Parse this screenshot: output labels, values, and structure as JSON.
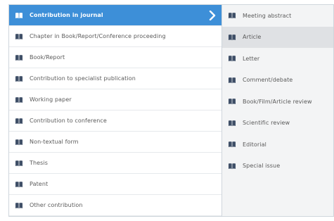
{
  "menu": {
    "left_items": [
      {
        "label": "Contribution in journal"
      },
      {
        "label": "Chapter in Book/Report/Conference proceeding"
      },
      {
        "label": "Book/Report"
      },
      {
        "label": "Contribution to specialist publication"
      },
      {
        "label": "Working paper"
      },
      {
        "label": "Contribution to conference"
      },
      {
        "label": "Non-textual form"
      },
      {
        "label": "Thesis"
      },
      {
        "label": "Patent"
      },
      {
        "label": "Other contribution"
      }
    ],
    "right_items": [
      {
        "label": "Meeting abstract"
      },
      {
        "label": "Article"
      },
      {
        "label": "Letter"
      },
      {
        "label": "Comment/debate"
      },
      {
        "label": "Book/Film/Article review"
      },
      {
        "label": "Scientific review"
      },
      {
        "label": "Editorial"
      },
      {
        "label": "Special issue"
      }
    ],
    "selected_left_index": 0,
    "selected_right_index": 1,
    "icon": "book-icon",
    "chevron_icon": "chevron-right-icon"
  },
  "colors": {
    "selected_bg": "#3d8fd8",
    "right_panel_bg": "#f3f4f5",
    "right_selected_bg": "#dfe1e4",
    "icon_color": "#3f4f67",
    "border": "#cfd6dc"
  }
}
